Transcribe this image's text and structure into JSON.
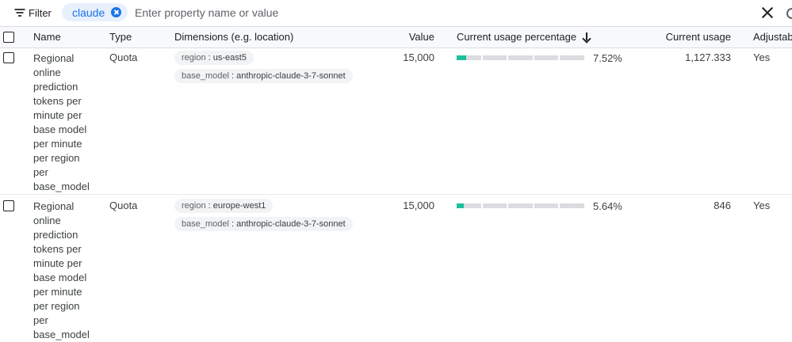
{
  "filter": {
    "label": "Filter",
    "chip": "claude",
    "placeholder": "Enter property name or value"
  },
  "columns": {
    "name": "Name",
    "type": "Type",
    "dimensions": "Dimensions (e.g. location)",
    "value": "Value",
    "usage_pct": "Current usage percentage",
    "usage": "Current usage",
    "adjustable": "Adjustab"
  },
  "rows": [
    {
      "name": "Regional online prediction tokens per minute per base model per minute per region per base_model",
      "type": "Quota",
      "dim1_key": "region",
      "dim1_val": "us-east5",
      "dim2_key": "base_model",
      "dim2_val": "anthropic-claude-3-7-sonnet",
      "value": "15,000",
      "usage_fraction": 0.0752,
      "usage_pct": "7.52%",
      "usage": "1,127.333",
      "adjustable": "Yes"
    },
    {
      "name": "Regional online prediction tokens per minute per base model per minute per region per base_model",
      "type": "Quota",
      "dim1_key": "region",
      "dim1_val": "europe-west1",
      "dim2_key": "base_model",
      "dim2_val": "anthropic-claude-3-7-sonnet",
      "value": "15,000",
      "usage_fraction": 0.0564,
      "usage_pct": "5.64%",
      "usage": "846",
      "adjustable": "Yes"
    }
  ],
  "colors": {
    "accent": "#1a73e8",
    "usage_fill": "#1dbf9d",
    "track": "#dadce0"
  }
}
